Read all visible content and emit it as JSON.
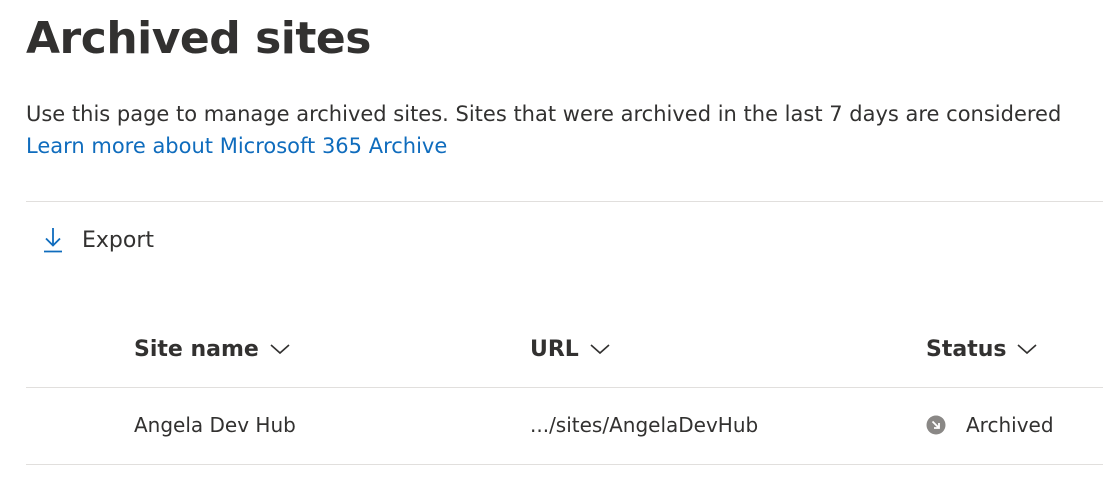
{
  "page": {
    "title": "Archived sites",
    "description": "Use this page to manage archived sites. Sites that were archived in the last 7 days are considered",
    "learn_more_link": "Learn more about Microsoft 365 Archive"
  },
  "toolbar": {
    "export_label": "Export",
    "export_icon": "download-arrow-icon"
  },
  "table": {
    "columns": [
      {
        "label": "Site name",
        "icon": "chevron-down-icon"
      },
      {
        "label": "URL",
        "icon": "chevron-down-icon"
      },
      {
        "label": "Status",
        "icon": "chevron-down-icon"
      }
    ],
    "rows": [
      {
        "site_name": "Angela Dev Hub",
        "url": ".../sites/AngelaDevHub",
        "status": "Archived",
        "status_icon": "archived-status-icon"
      }
    ]
  },
  "colors": {
    "text": "#323130",
    "link": "#0f6cbd",
    "divider": "#e1dfdd",
    "status_icon": "#8a8886"
  }
}
